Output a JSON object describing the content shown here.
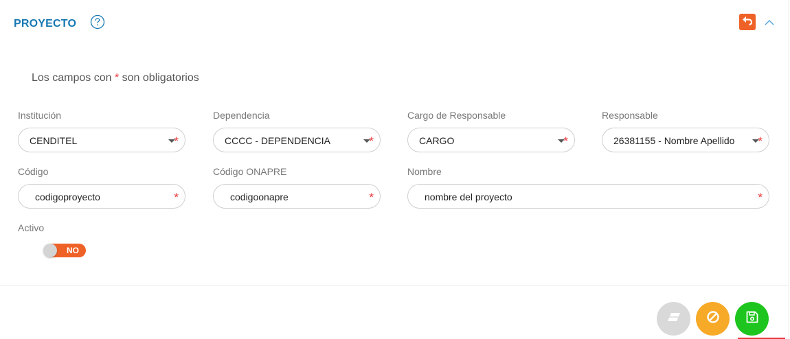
{
  "header": {
    "title": "PROYECTO",
    "help_icon": "help-circle-icon",
    "back_icon": "reply-arrow-icon",
    "collapse_icon": "chevron-up-icon"
  },
  "required_note": {
    "before": "Los campos con",
    "star": "*",
    "after": "son obligatorios"
  },
  "fields": {
    "institucion": {
      "label": "Institución",
      "value": "CENDITEL"
    },
    "dependencia": {
      "label": "Dependencia",
      "value": "CCCC - DEPENDENCIA"
    },
    "cargo": {
      "label": "Cargo de Responsable",
      "value": "CARGO"
    },
    "responsable": {
      "label": "Responsable",
      "value": "26381155 - Nombre Apellido"
    },
    "codigo": {
      "label": "Código",
      "value": "codigoproyecto"
    },
    "codigo_onapre": {
      "label": "Código ONAPRE",
      "value": "codigoonapre"
    },
    "nombre": {
      "label": "Nombre",
      "value": "nombre del proyecto"
    },
    "activo": {
      "label": "Activo",
      "toggle_text": "NO",
      "checked": false
    }
  },
  "required_mark": "*",
  "actions": {
    "clear_icon": "eraser-icon",
    "cancel_icon": "ban-icon",
    "save_icon": "floppy-disk-icon"
  },
  "colors": {
    "title": "#1677b3",
    "accent_orange": "#ef6227",
    "required": "#e8373b",
    "cancel": "#f7a928",
    "save": "#1ec51e",
    "clear": "#d9d9d9"
  }
}
